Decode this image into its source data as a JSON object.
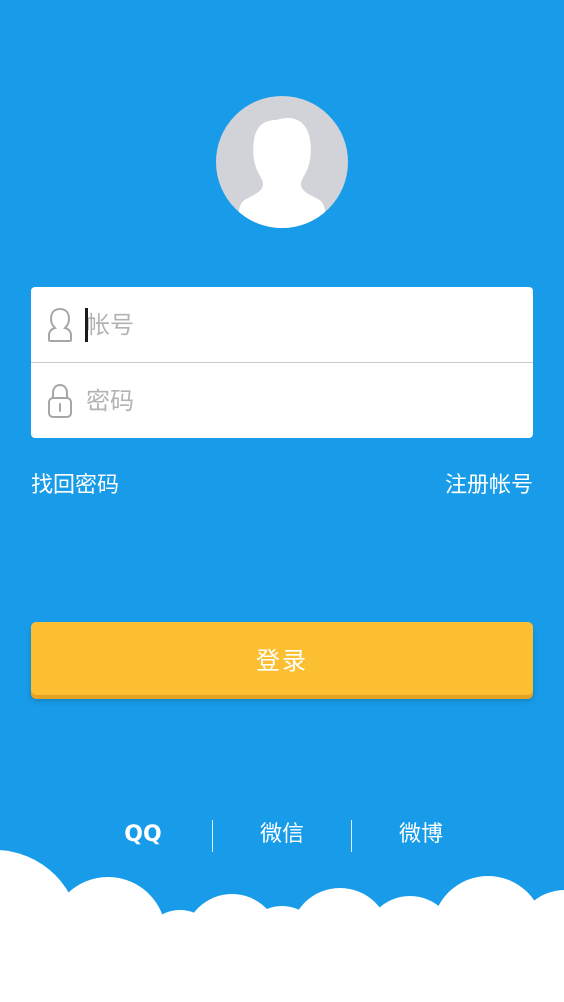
{
  "avatar": {
    "icon": "user-avatar-icon"
  },
  "form": {
    "account": {
      "placeholder": "帐号",
      "value": "",
      "icon": "user-icon"
    },
    "password": {
      "placeholder": "密码",
      "value": "",
      "icon": "lock-icon"
    }
  },
  "links": {
    "forgot_password": "找回密码",
    "register": "注册帐号"
  },
  "login_button": {
    "label": "登录"
  },
  "social_login": [
    {
      "label": "QQ"
    },
    {
      "label": "微信"
    },
    {
      "label": "微博"
    }
  ],
  "colors": {
    "background": "#189ce9",
    "button": "#fcbf32",
    "card": "#ffffff",
    "avatar": "#d1d3d8",
    "placeholder": "#b3b3b3"
  }
}
